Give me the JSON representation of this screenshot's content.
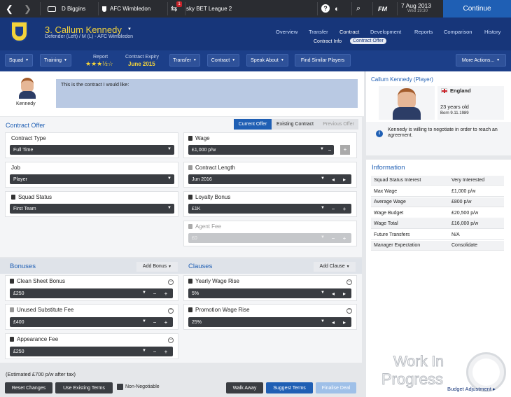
{
  "topbar": {
    "manager": "D Biggins",
    "club": "AFC Wimbledon",
    "competition": "sky BET League 2",
    "notif": "1",
    "help": "?",
    "date": "7 Aug 2013",
    "day_time": "Wed 19:30",
    "continue": "Continue",
    "fm": "FM"
  },
  "player": {
    "title": "3. Callum Kennedy",
    "subtitle": "Defender (Left) / M (L) - AFC Wimbledon",
    "first_name": "Kennedy"
  },
  "nav": [
    "Overview",
    "Transfer",
    "Contract",
    "Development",
    "Reports",
    "Comparison",
    "History"
  ],
  "subnav": [
    "Contract Info",
    "Contract Offer"
  ],
  "subbar": {
    "squad": "Squad",
    "training": "Training",
    "report": "Report",
    "stars": "★★★½☆",
    "contract_expiry_label": "Contract Expiry",
    "contract_expiry": "June 2015",
    "transfer": "Transfer",
    "contract": "Contract",
    "speak_about": "Speak About",
    "find_similar": "Find Similar Players",
    "more_actions": "More Actions..."
  },
  "message": "This is the contract I would like:",
  "offer": {
    "heading": "Contract Offer",
    "tabs": [
      "Current Offer",
      "Existing Contract",
      "Previous Offer"
    ],
    "contract_type_label": "Contract Type",
    "contract_type": "Full Time",
    "job_label": "Job",
    "job": "Player",
    "squad_status_label": "Squad Status",
    "squad_status": "First Team",
    "wage_label": "Wage",
    "wage": "£1,000 p/w",
    "length_label": "Contract Length",
    "length": "Jun 2016",
    "loyalty_label": "Loyalty Bonus",
    "loyalty": "£1K",
    "agent_label": "Agent Fee",
    "agent": "£0"
  },
  "bonuses": {
    "heading": "Bonuses",
    "add": "Add Bonus",
    "items": [
      {
        "label": "Clean Sheet Bonus",
        "value": "£250"
      },
      {
        "label": "Unused Substitute Fee",
        "value": "£400"
      },
      {
        "label": "Appearance Fee",
        "value": "£250"
      }
    ]
  },
  "clauses": {
    "heading": "Clauses",
    "add": "Add Clause",
    "items": [
      {
        "label": "Yearly Wage Rise",
        "value": "5%"
      },
      {
        "label": "Promotion Wage Rise",
        "value": "25%"
      }
    ]
  },
  "footer": {
    "estimate": "(Estimated £700 p/w after tax)",
    "reset": "Reset Changes",
    "use_existing": "Use Existing Terms",
    "non_negotiable": "Non-Negotiable",
    "walk_away": "Walk Away",
    "suggest": "Suggest Terms",
    "finalise": "Finalise Deal",
    "budget": "Budget Adjustment"
  },
  "side": {
    "heading": "Callum Kennedy (Player)",
    "nation": "England",
    "age": "23 years old",
    "born": "Born 9.11.1989",
    "note": "Kennedy is willing to negotiate in order to reach an agreement."
  },
  "info": {
    "heading": "Information",
    "rows": [
      [
        "Squad Status Interest",
        "Very Interested"
      ],
      [
        "Max Wage",
        "£1,000 p/w"
      ],
      [
        "Average Wage",
        "£800 p/w"
      ],
      [
        "Wage Budget",
        "£20,500 p/w"
      ],
      [
        "Wage Total",
        "£16,000 p/w"
      ],
      [
        "Future Transfers",
        "N/A"
      ],
      [
        "Manager Expectation",
        "Consolidate"
      ]
    ]
  },
  "watermark": {
    "line1": "Work In",
    "line2": "Progress",
    "seal": "SPORTS INTERACTIVE"
  },
  "colors": {
    "header": "#17367a",
    "accent": "#1f5fb4",
    "topbar": "#2a2c31"
  }
}
